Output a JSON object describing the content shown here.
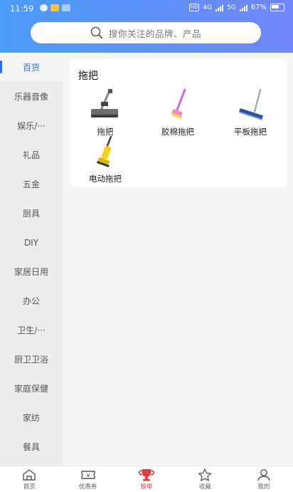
{
  "status": {
    "time": "11:59",
    "battery": "67%",
    "net1": "4G",
    "net2": "5G"
  },
  "search": {
    "placeholder": "搜你关注的品牌、产品"
  },
  "sidebar": {
    "items": [
      {
        "label": "百货"
      },
      {
        "label": "乐器音像"
      },
      {
        "label": "娱乐/···"
      },
      {
        "label": "礼品"
      },
      {
        "label": "五金"
      },
      {
        "label": "厨具"
      },
      {
        "label": "DIY"
      },
      {
        "label": "家居日用"
      },
      {
        "label": "办公"
      },
      {
        "label": "卫生/···"
      },
      {
        "label": "厨卫卫浴"
      },
      {
        "label": "家庭保健"
      },
      {
        "label": "家纺"
      },
      {
        "label": "餐具"
      }
    ]
  },
  "category": {
    "title": "拖把",
    "products": [
      {
        "label": "拖把",
        "icon": "mop-icon"
      },
      {
        "label": "胶棉拖把",
        "icon": "sponge-mop-icon"
      },
      {
        "label": "平板拖把",
        "icon": "flat-mop-icon"
      },
      {
        "label": "电动拖把",
        "icon": "electric-mop-icon"
      }
    ]
  },
  "tabbar": {
    "tabs": [
      {
        "label": "首页",
        "icon": "home-icon"
      },
      {
        "label": "优惠券",
        "icon": "coupon-icon"
      },
      {
        "label": "榜单",
        "icon": "trophy-icon"
      },
      {
        "label": "收藏",
        "icon": "star-icon"
      },
      {
        "label": "我的",
        "icon": "user-icon"
      }
    ]
  },
  "colors": {
    "accent": "#2f6fe0",
    "header_start": "#4a9cf6",
    "header_end": "#6f86f7",
    "tab_active": "#e23b3b"
  }
}
